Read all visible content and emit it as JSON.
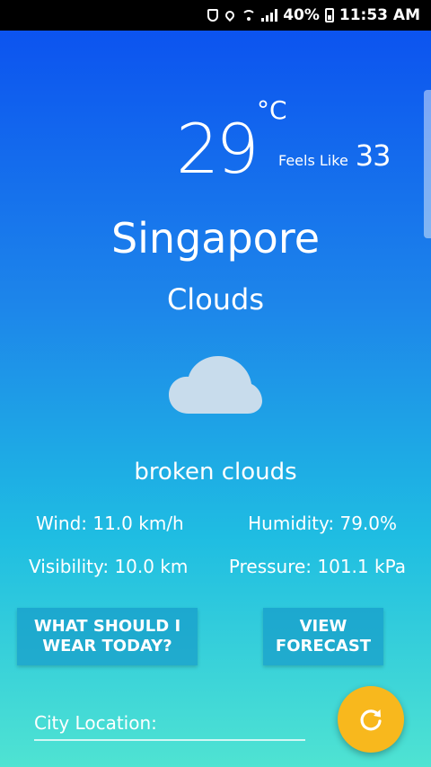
{
  "status_bar": {
    "battery_percent": "40%",
    "time": "11:53 AM"
  },
  "weather": {
    "temperature": "29",
    "unit": "°C",
    "feels_like_label": "Feels Like",
    "feels_like_value": "33",
    "city": "Singapore",
    "condition": "Clouds",
    "condition_icon": "cloud-icon",
    "description": "broken clouds"
  },
  "stats": {
    "wind": "Wind: 11.0 km/h",
    "humidity": "Humidity: 79.0%",
    "visibility": "Visibility: 10.0 km",
    "pressure": "Pressure: 101.1 kPa"
  },
  "buttons": {
    "wear_line1": "WHAT SHOULD I",
    "wear_line2": "WEAR TODAY?",
    "forecast_line1": "VIEW",
    "forecast_line2": "FORECAST"
  },
  "city_input": {
    "placeholder": "City Location:",
    "value": ""
  },
  "fab": {
    "icon": "refresh-icon"
  },
  "colors": {
    "gradient_top": "#0a4ef0",
    "gradient_bottom": "#4fe3d2",
    "fab": "#f8b81d",
    "button_bg": "#1496c8"
  }
}
